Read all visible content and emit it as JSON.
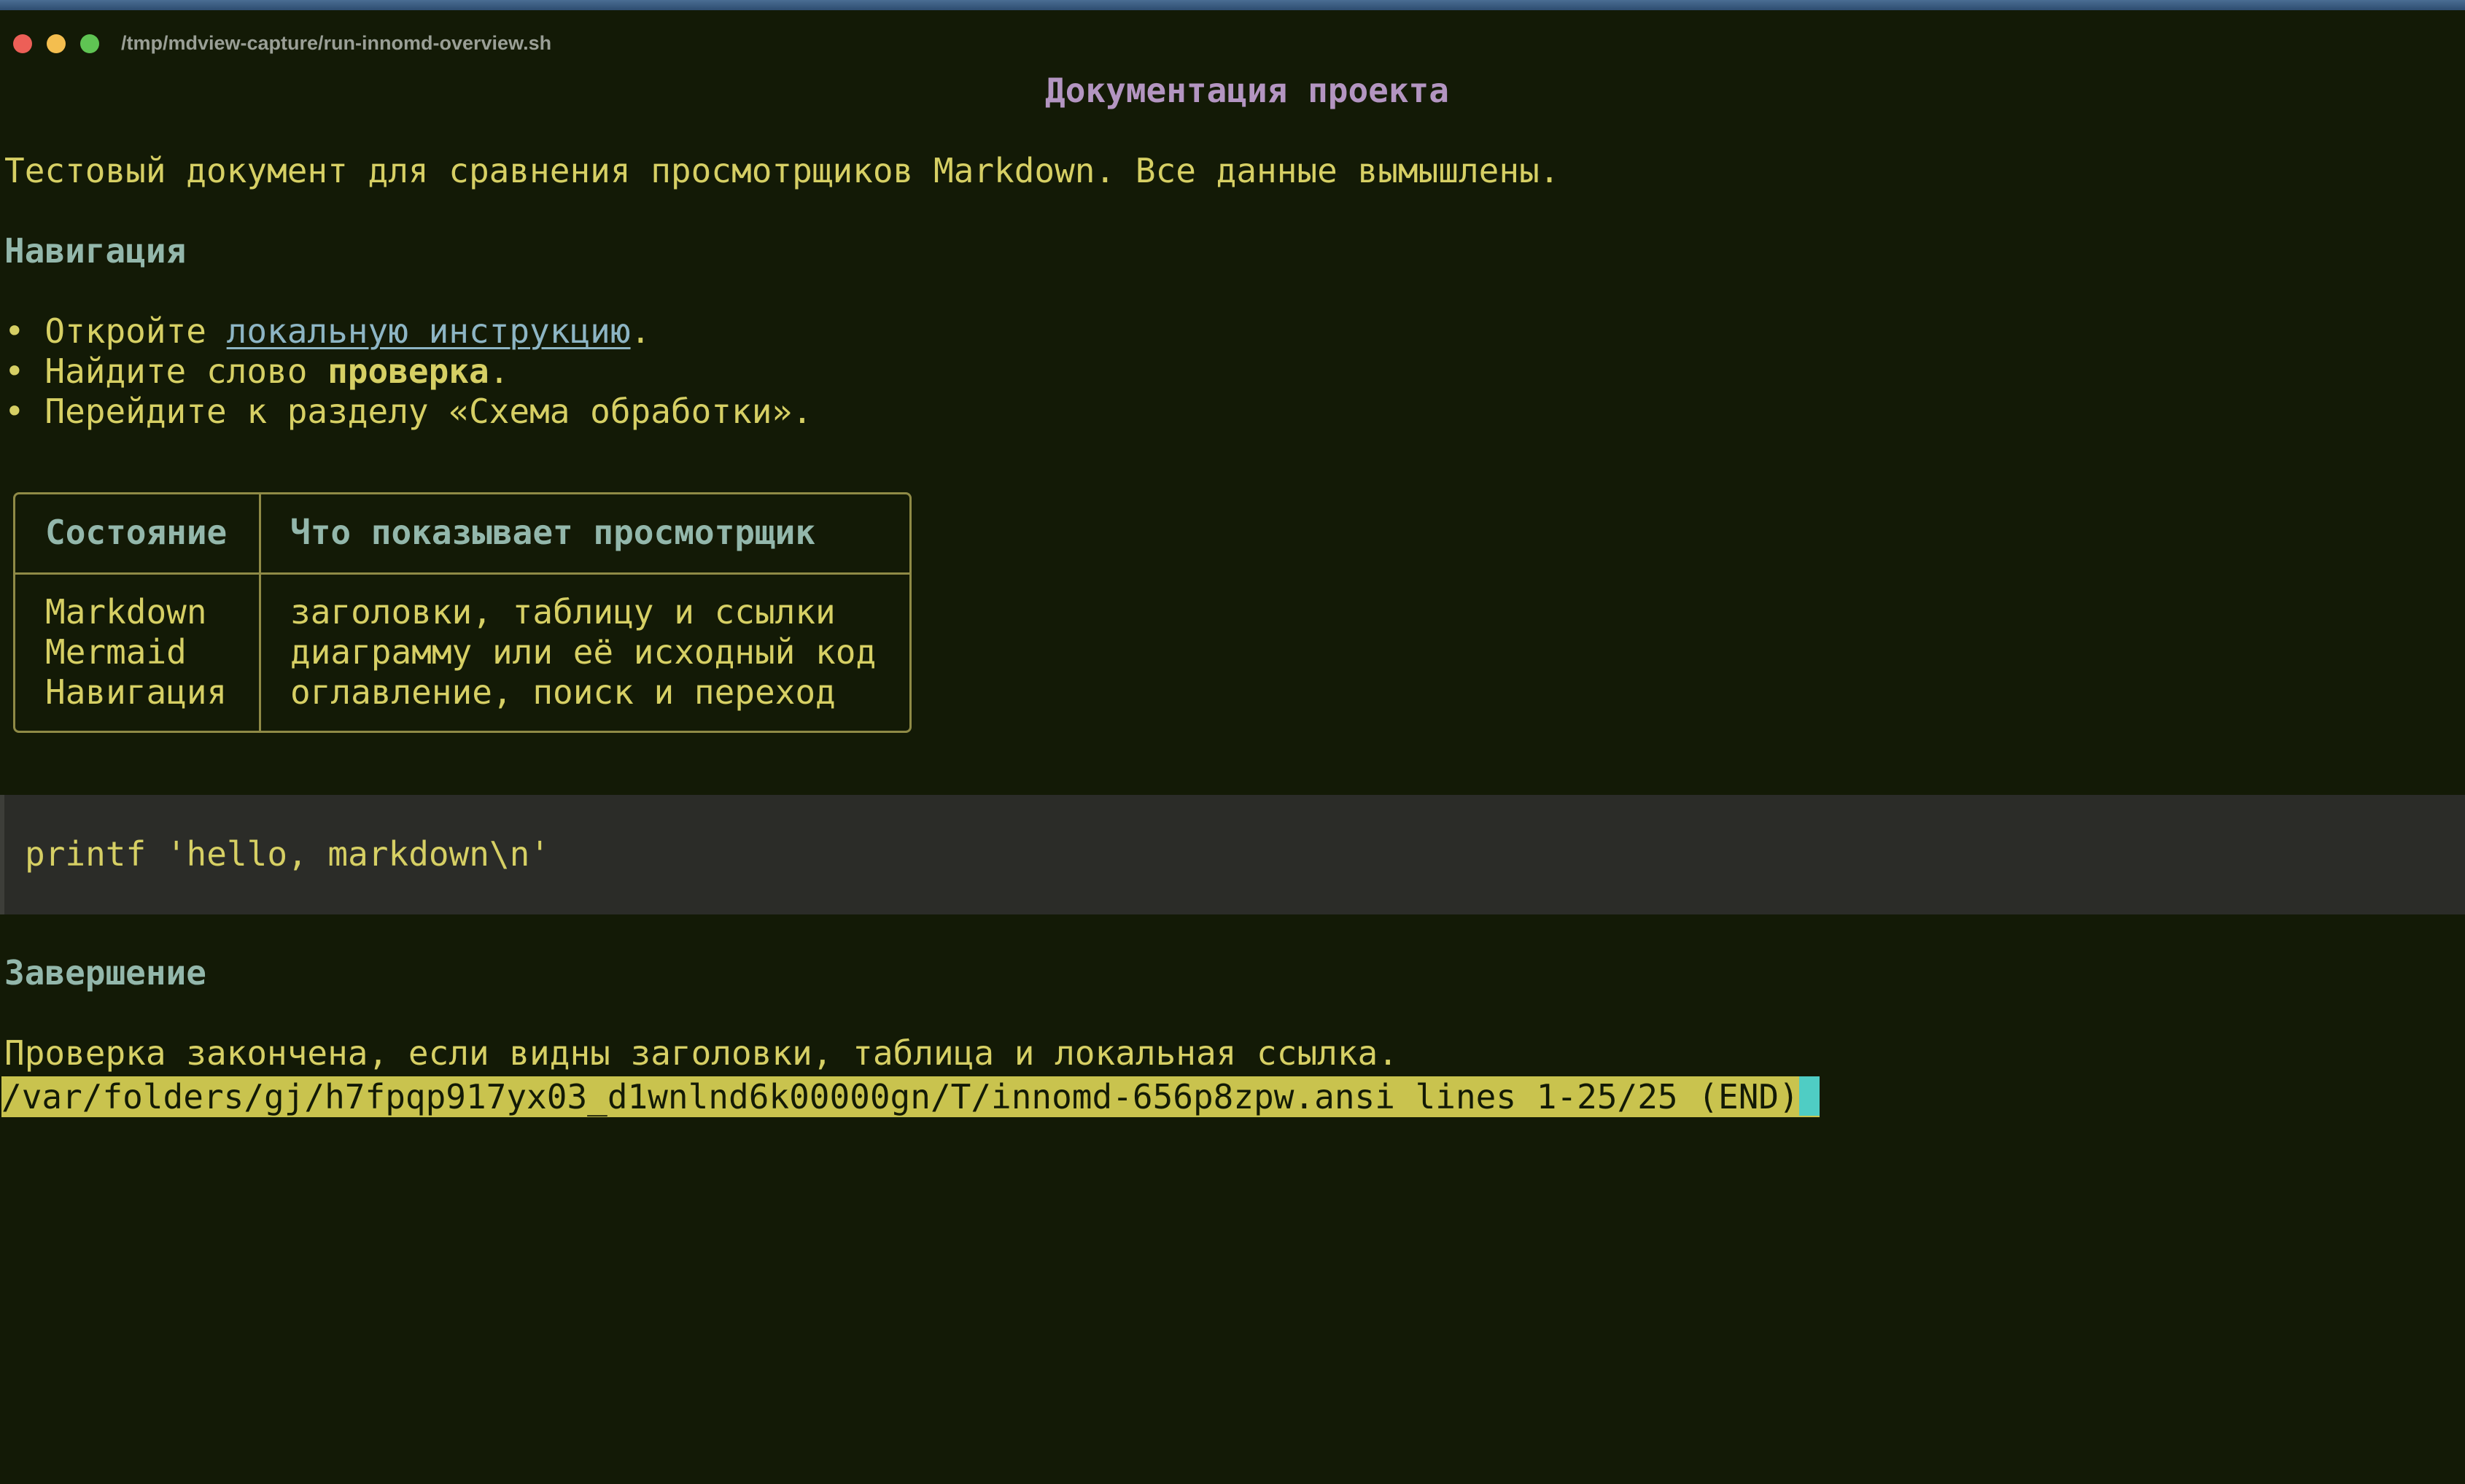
{
  "window": {
    "title": "/tmp/mdview-capture/run-innomd-overview.sh"
  },
  "document": {
    "title": "Документация проекта",
    "intro": "Тестовый документ для сравнения просмотрщиков Markdown. Все данные вымышлены.",
    "nav_heading": "Навигация",
    "bullets": [
      {
        "before": "• Откройте ",
        "link": "локальную инструкцию",
        "after": "."
      },
      {
        "before": "• Найдите слово ",
        "bold": "проверка",
        "after": "."
      },
      {
        "text": "• Перейдите к разделу «Схема обработки»."
      }
    ],
    "table": {
      "headers": [
        "Состояние",
        "Что показывает просмотрщик"
      ],
      "rows": [
        [
          "Markdown",
          "заголовки, таблицу и ссылки"
        ],
        [
          "Mermaid",
          "диаграмму или её исходный код"
        ],
        [
          "Навигация",
          "оглавление, поиск и переход"
        ]
      ]
    },
    "code": "printf 'hello, markdown\\n'",
    "finish_heading": "Завершение",
    "finish_text": "Проверка закончена, если видны заголовки, таблица и локальная ссылка."
  },
  "pager": {
    "status": "/var/folders/gj/h7fpqp917yx03_d1wnlnd6k00000gn/T/innomd-656p8zpw.ansi lines 1-25/25 (END)"
  },
  "colors": {
    "background": "#131a06",
    "text": "#d6cf64",
    "heading": "#93b7ab",
    "title": "#b395c1",
    "link": "#8db5c4",
    "status_bg": "#c9c34e",
    "cursor": "#4fcdc4"
  }
}
